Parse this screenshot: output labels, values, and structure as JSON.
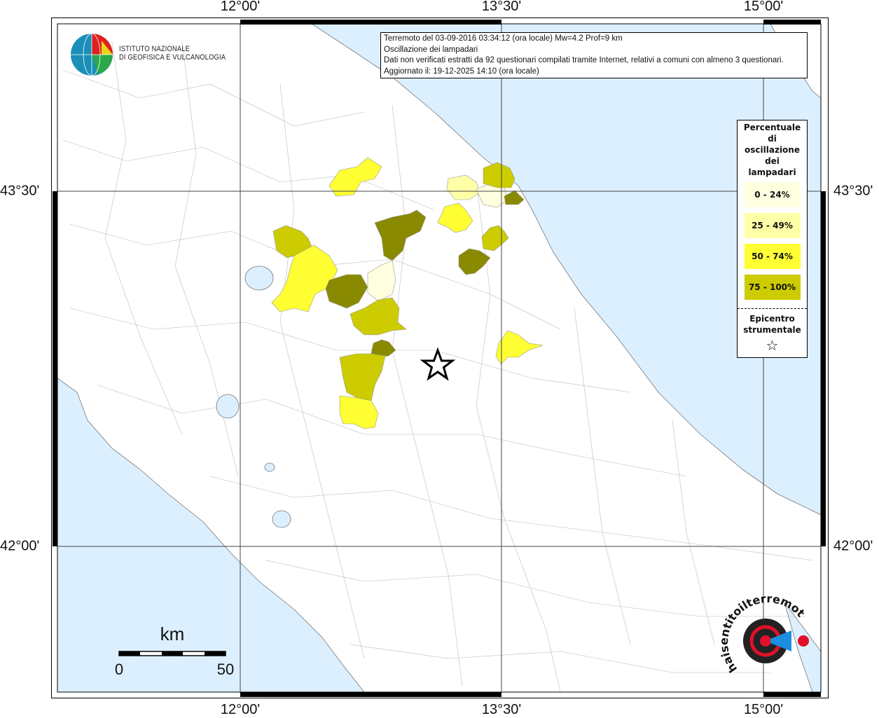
{
  "title_box": {
    "line1": "Terremoto del 03-09-2016 03:34:12 (ora locale) Mw=4.2 Prof=9 km",
    "line2": "Oscillazione dei lampadari",
    "line3": "Dati non verificati estratti da 92 questionari compilati tramite Internet, relativi a comuni con almeno 3 questionari.",
    "line4": "Aggiornato il: 19-12-2025 14:10 (ora locale)"
  },
  "axes": {
    "longitudes": [
      "12°00'",
      "13°30'",
      "15°00'"
    ],
    "latitudes": [
      "43°30'",
      "42°00'"
    ]
  },
  "legend": {
    "title": [
      "Percentuale",
      "di",
      "oscillazione",
      "dei",
      "lampadari"
    ],
    "classes": [
      {
        "label": "0 - 24%",
        "color": "#ffffe0"
      },
      {
        "label": "25 - 49%",
        "color": "#ffffa8"
      },
      {
        "label": "50 - 74%",
        "color": "#ffff33"
      },
      {
        "label": "75 - 100%",
        "color": "#cccc00"
      }
    ],
    "epicenter_label": [
      "Epicentro",
      "strumentale"
    ],
    "epicenter_icon": "star-outline"
  },
  "logo_ingv": {
    "line1": "ISTITUTO NAZIONALE",
    "line2": "DI GEOFISICA E VULCANOLOGIA"
  },
  "logo_hsit": {
    "text": "www.haisentitoilterremoto.it"
  },
  "scale_bar": {
    "unit": "km",
    "start": "0",
    "end": "50"
  },
  "colors": {
    "sea": "#dcefff",
    "grid": "#444444",
    "dark_class": "#8a8a00"
  }
}
